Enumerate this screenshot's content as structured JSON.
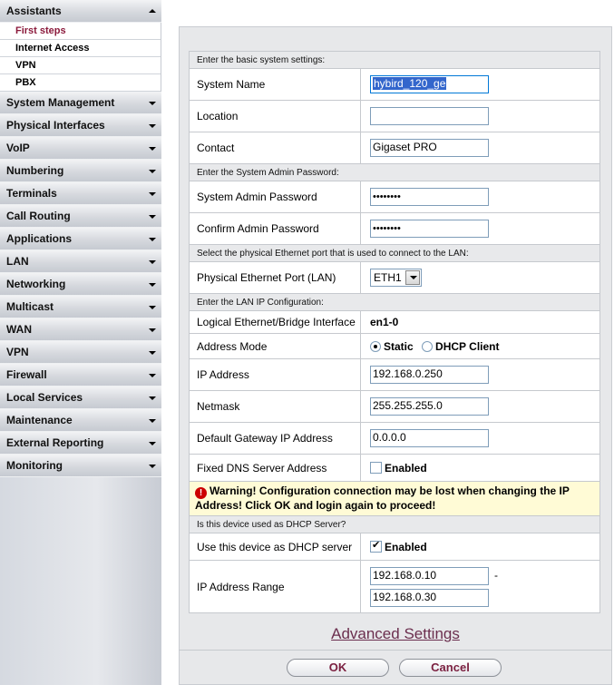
{
  "sidebar": {
    "assistants": "Assistants",
    "sub_items": [
      "First steps",
      "Internet Access",
      "VPN",
      "PBX"
    ],
    "menu": [
      "System Management",
      "Physical Interfaces",
      "VoIP",
      "Numbering",
      "Terminals",
      "Call Routing",
      "Applications",
      "LAN",
      "Networking",
      "Multicast",
      "WAN",
      "VPN",
      "Firewall",
      "Local Services",
      "Maintenance",
      "External Reporting",
      "Monitoring"
    ]
  },
  "form": {
    "sec_basic": "Enter the basic system settings:",
    "system_name_label": "System Name",
    "system_name_value": "hybird_120_ge",
    "location_label": "Location",
    "location_value": "",
    "contact_label": "Contact",
    "contact_value": "Gigaset PRO",
    "sec_password": "Enter the System Admin Password:",
    "admin_pw_label": "System Admin Password",
    "admin_pw_value": "••••••••",
    "confirm_pw_label": "Confirm Admin Password",
    "confirm_pw_value": "••••••••",
    "sec_port": "Select the physical Ethernet port that is used to connect to the LAN:",
    "port_label": "Physical Ethernet Port (LAN)",
    "port_value": "ETH1",
    "sec_lanip": "Enter the LAN IP Configuration:",
    "logical_label": "Logical Ethernet/Bridge Interface",
    "logical_value": "en1-0",
    "address_mode_label": "Address Mode",
    "mode_static": "Static",
    "mode_dhcp": "DHCP Client",
    "ip_label": "IP Address",
    "ip_value": "192.168.0.250",
    "netmask_label": "Netmask",
    "netmask_value": "255.255.255.0",
    "gateway_label": "Default Gateway IP Address",
    "gateway_value": "0.0.0.0",
    "dns_label": "Fixed DNS Server Address",
    "dns_enabled": "Enabled",
    "warning": "Warning! Configuration connection may be lost when changing the IP Address! Click OK and login again to proceed!",
    "sec_dhcp": "Is this device used as DHCP Server?",
    "dhcp_label": "Use this device as DHCP server",
    "dhcp_enabled": "Enabled",
    "range_label": "IP Address Range",
    "range_start": "192.168.0.10",
    "range_dash": "-",
    "range_end": "192.168.0.30"
  },
  "footer": {
    "advanced": "Advanced Settings",
    "ok": "OK",
    "cancel": "Cancel"
  },
  "colors": {
    "accent": "#7a1f3f",
    "warning_bg": "#fffbd6"
  }
}
